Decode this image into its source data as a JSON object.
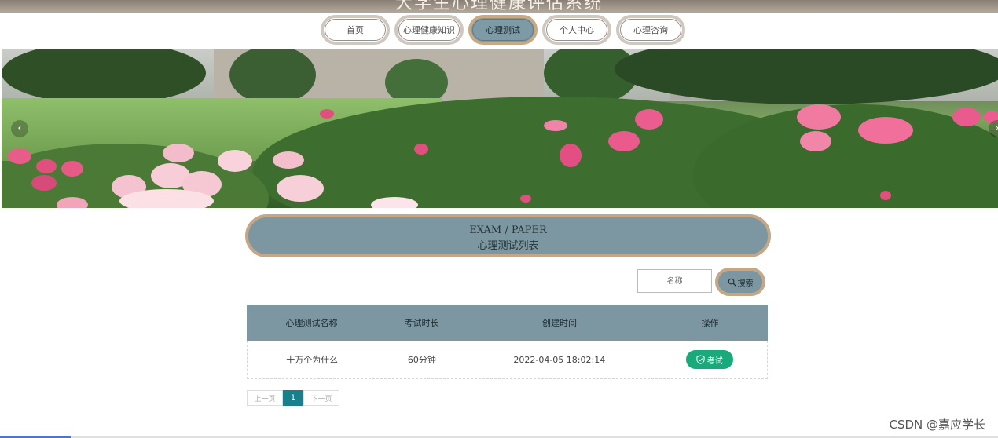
{
  "header": {
    "site_title": "大学生心理健康评估系统"
  },
  "nav": {
    "items": [
      {
        "label": "首页"
      },
      {
        "label": "心理健康知识"
      },
      {
        "label": "心理测试"
      },
      {
        "label": "个人中心"
      },
      {
        "label": "心理咨询"
      }
    ],
    "active": "心理测试"
  },
  "banner": {
    "prev_icon": "chevron-left-icon",
    "next_icon": "chevron-right-icon"
  },
  "section": {
    "title_en": "EXAM / PAPER",
    "title_cn": "心理测试列表"
  },
  "search": {
    "placeholder": "名称",
    "button_label": "搜索"
  },
  "table": {
    "headers": [
      "心理测试名称",
      "考试时长",
      "创建时间",
      "操作"
    ],
    "rows": [
      {
        "name": "十万个为什么",
        "duration": "60分钟",
        "created": "2022-04-05 18:02:14",
        "action": "考试"
      }
    ]
  },
  "pagination": {
    "prev": "上一页",
    "current": "1",
    "next": "下一页"
  },
  "watermark": "CSDN @嘉应学长",
  "colors": {
    "accent": "#7c97a1",
    "border": "#c4a787",
    "exam_button": "#19a97b",
    "page_active": "#17808a"
  }
}
